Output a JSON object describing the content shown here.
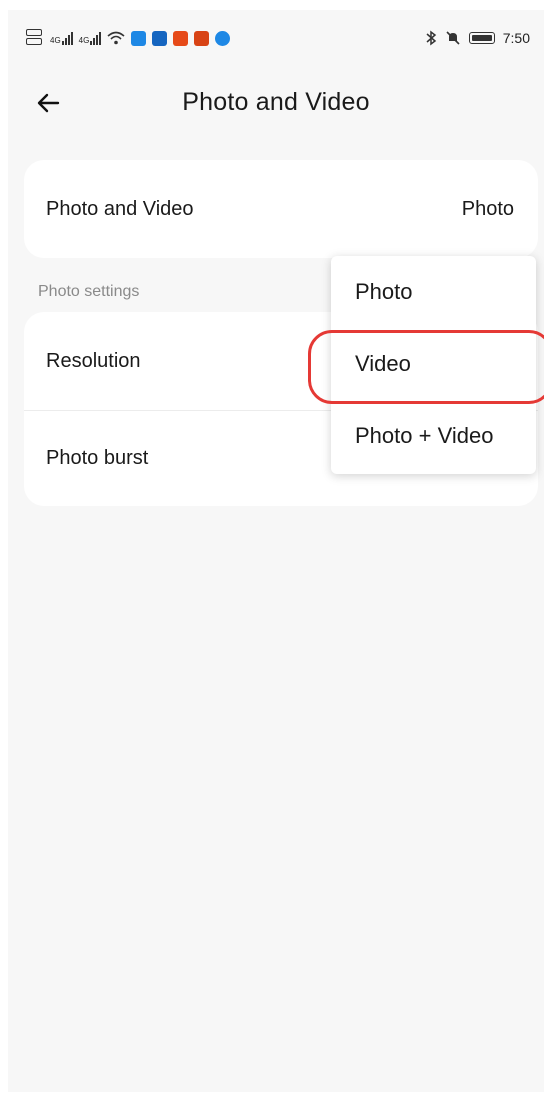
{
  "status_bar": {
    "time": "7:50",
    "signal_left_label": "4G",
    "signal_right_label": "4G"
  },
  "header": {
    "title": "Photo and Video"
  },
  "mode_card": {
    "label": "Photo and Video",
    "value": "Photo"
  },
  "photo_settings": {
    "section_label": "Photo settings",
    "rows": [
      {
        "label": "Resolution"
      },
      {
        "label": "Photo burst"
      }
    ]
  },
  "dropdown": {
    "options": [
      {
        "label": "Photo"
      },
      {
        "label": "Video"
      },
      {
        "label": "Photo + Video"
      }
    ],
    "highlighted_index": 1,
    "highlight_color": "#e53935"
  },
  "colors": {
    "background": "#f7f7f7",
    "card": "#ffffff",
    "section_label": "#8a8a8a"
  },
  "icons": {
    "back": "arrow-left-icon",
    "bluetooth": "bluetooth-icon",
    "mute": "bell-off-icon",
    "battery": "battery-icon",
    "wifi": "wifi-icon"
  }
}
